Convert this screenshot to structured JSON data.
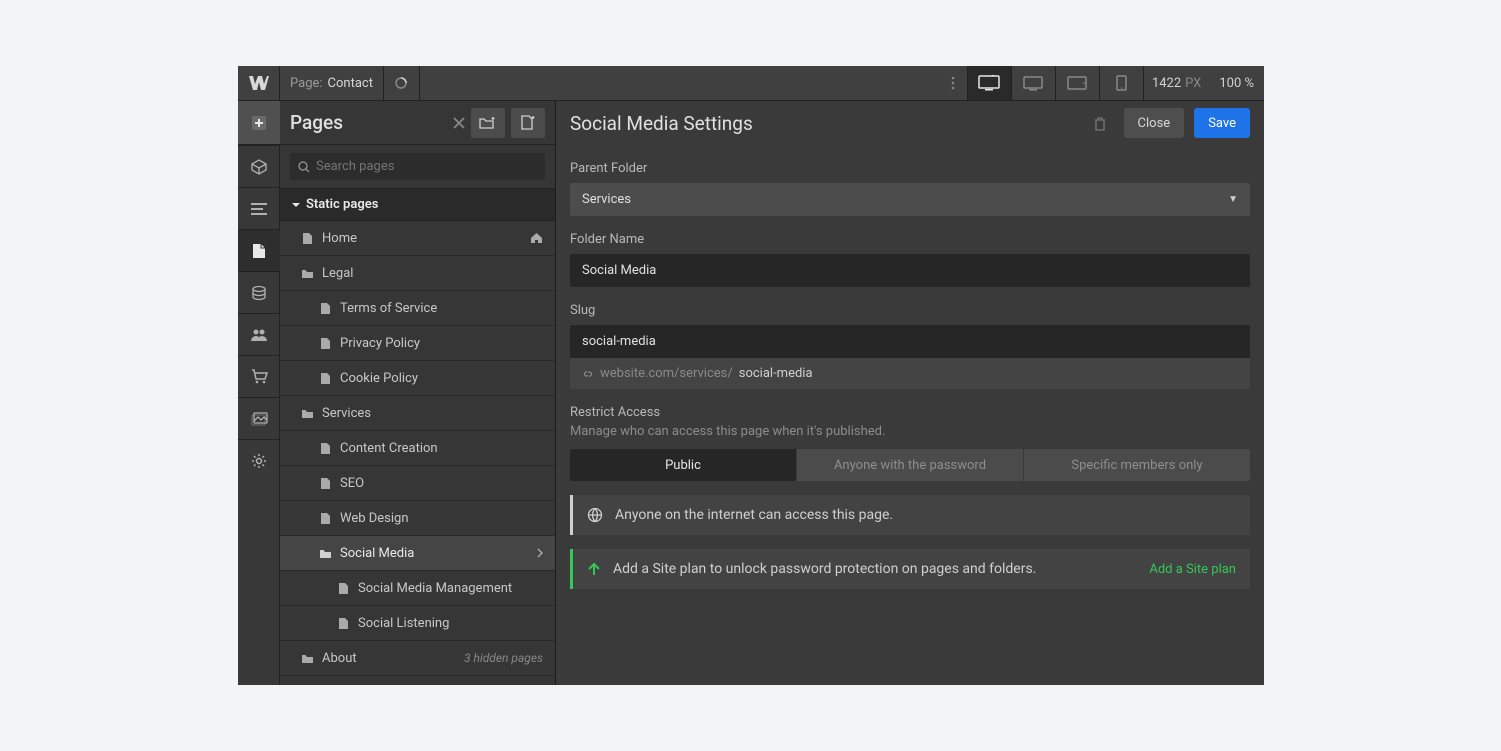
{
  "topbar": {
    "page_prefix": "Page:",
    "page_name": "Contact",
    "canvas_width": "1422",
    "px_label": "PX",
    "zoom": "100 %"
  },
  "panel": {
    "title": "Pages",
    "search_placeholder": "Search pages",
    "group_static": "Static pages"
  },
  "tree": {
    "home": "Home",
    "legal": "Legal",
    "tos": "Terms of Service",
    "privacy": "Privacy Policy",
    "cookie": "Cookie Policy",
    "services": "Services",
    "content_creation": "Content Creation",
    "seo": "SEO",
    "web_design": "Web Design",
    "social_media": "Social Media",
    "smm": "Social Media Management",
    "social_listening": "Social Listening",
    "about": "About",
    "hidden_note": "3 hidden pages"
  },
  "settings": {
    "title": "Social Media Settings",
    "close": "Close",
    "save": "Save",
    "parent_folder_label": "Parent Folder",
    "parent_folder_value": "Services",
    "folder_name_label": "Folder Name",
    "folder_name_value": "Social Media",
    "slug_label": "Slug",
    "slug_value": "social-media",
    "url_prefix": "website.com/services/",
    "url_slug": "social-media",
    "restrict_label": "Restrict Access",
    "restrict_sub": "Manage who can access this page when it's published.",
    "seg_public": "Public",
    "seg_password": "Anyone with the password",
    "seg_members": "Specific members only",
    "notice_public": "Anyone on the internet can access this page.",
    "notice_plan": "Add a Site plan to unlock password protection on pages and folders.",
    "notice_plan_link": "Add a Site plan"
  }
}
